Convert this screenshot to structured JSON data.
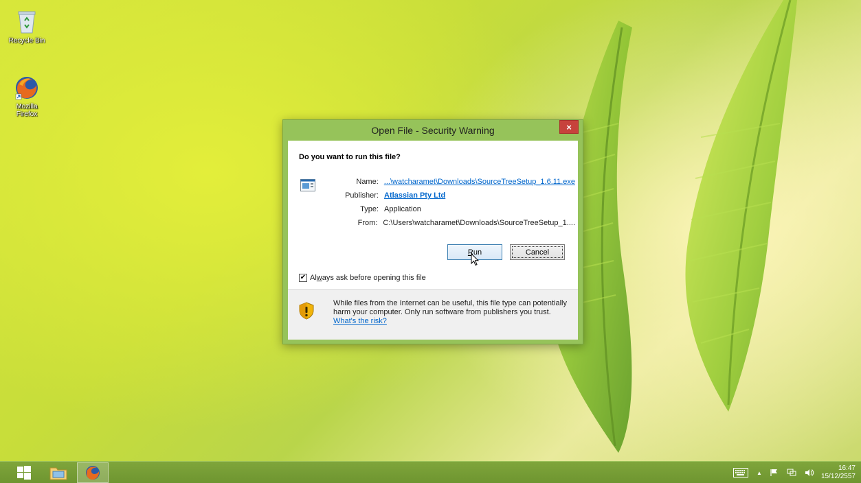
{
  "desktop": {
    "icons": [
      {
        "label": "Recycle Bin",
        "icon": "recycle-bin-icon"
      },
      {
        "label": "Mozilla\nFirefox",
        "icon": "firefox-icon"
      }
    ]
  },
  "dialog": {
    "title": "Open File - Security Warning",
    "close_label": "×",
    "question": "Do you want to run this file?",
    "fields": {
      "name_label": "Name:",
      "name_value": "...\\watcharamet\\Downloads\\SourceTreeSetup_1.6.11.exe",
      "publisher_label": "Publisher:",
      "publisher_value": "Atlassian Pty Ltd",
      "type_label": "Type:",
      "type_value": "Application",
      "from_label": "From:",
      "from_value": "C:\\Users\\watcharamet\\Downloads\\SourceTreeSetup_1...."
    },
    "run_label": "Run",
    "cancel_label": "Cancel",
    "checkbox_label": "Always ask before opening this file",
    "checkbox_checked": true,
    "warning_text": "While files from the Internet can be useful, this file type can potentially harm your computer. Only run software from publishers you trust.",
    "risk_link": "What's the risk?"
  },
  "taskbar": {
    "clock_time": "16:47",
    "clock_date": "15/12/2557",
    "tray_up_arrow": "▲",
    "accent_color": "#7fa53b"
  }
}
